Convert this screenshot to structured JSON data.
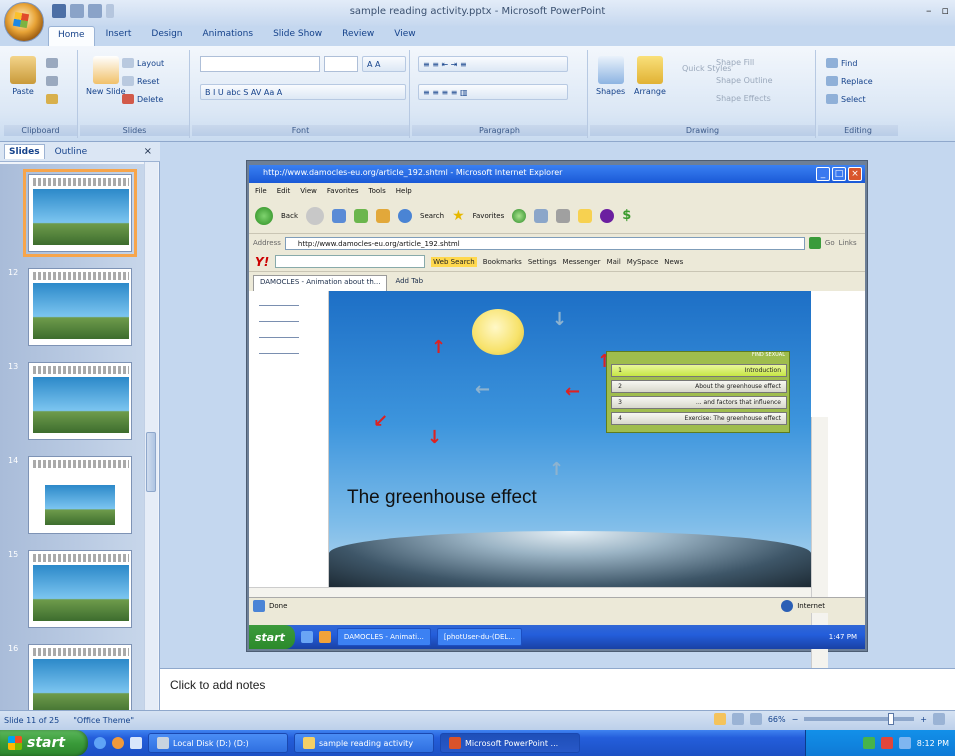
{
  "window": {
    "title": "sample reading activity.pptx - Microsoft PowerPoint",
    "minimize": "–",
    "restore": "▫"
  },
  "ribbon": {
    "tabs": [
      "Home",
      "Insert",
      "Design",
      "Animations",
      "Slide Show",
      "Review",
      "View"
    ],
    "active_tab": "Home",
    "groups": {
      "clipboard": {
        "label": "Clipboard",
        "paste": "Paste"
      },
      "slides": {
        "label": "Slides",
        "new_slide": "New Slide",
        "layout": "Layout",
        "reset": "Reset",
        "delete": "Delete"
      },
      "font": {
        "label": "Font"
      },
      "paragraph": {
        "label": "Paragraph"
      },
      "drawing": {
        "label": "Drawing",
        "shapes": "Shapes",
        "arrange": "Arrange",
        "quick_styles": "Quick Styles",
        "shape_fill": "Shape Fill",
        "shape_outline": "Shape Outline",
        "shape_effects": "Shape Effects"
      },
      "editing": {
        "label": "Editing",
        "find": "Find",
        "replace": "Replace",
        "select": "Select"
      }
    }
  },
  "left_pane": {
    "tabs": [
      "Slides",
      "Outline"
    ],
    "active_tab": "Slides",
    "close": "×",
    "slide_numbers": [
      "",
      "12",
      "13",
      "14",
      "15",
      "16"
    ]
  },
  "browser": {
    "title": "http://www.damocles-eu.org/article_192.shtml - Microsoft Internet Explorer",
    "menu": [
      "File",
      "Edit",
      "View",
      "Favorites",
      "Tools",
      "Help"
    ],
    "toolbar": {
      "back": "Back",
      "search": "Search",
      "favorites": "Favorites"
    },
    "address_label": "Address",
    "address": "http://www.damocles-eu.org/article_192.shtml",
    "go": "Go",
    "links": "Links",
    "yahoo": {
      "logo": "Y!",
      "web_search": "Web Search",
      "bookmarks": "Bookmarks",
      "settings": "Settings",
      "messenger": "Messenger",
      "mail": "Mail",
      "myspace": "MySpace",
      "news": "News"
    },
    "tab_label": "DAMOCLES - Animation about th...",
    "add_tab": "Add Tab",
    "status": "Done",
    "zone": "Internet"
  },
  "animation": {
    "heading": "The greenhouse effect",
    "menu_head": "FIND SEXUAL",
    "menu_items": [
      {
        "num": "1",
        "label": "Introduction"
      },
      {
        "num": "2",
        "label": "About the greenhouse effect"
      },
      {
        "num": "3",
        "label": "... and factors that influence"
      },
      {
        "num": "4",
        "label": "Exercise: The greenhouse effect"
      }
    ],
    "active_item": "1"
  },
  "inner_taskbar": {
    "start": "start",
    "tasks": [
      "DAMOCLES - Animati...",
      "[photUser-du-(DEL..."
    ],
    "time": "1:47 PM"
  },
  "notes": {
    "placeholder": "Click to add notes"
  },
  "status_bar": {
    "slide": "Slide 11 of 25",
    "theme": "\"Office Theme\"",
    "zoom": "66%"
  },
  "taskbar": {
    "start": "start",
    "items": [
      "Local Disk (D:) (D:)",
      "sample reading activity",
      "Microsoft PowerPoint ..."
    ],
    "time": "8:12 PM"
  }
}
